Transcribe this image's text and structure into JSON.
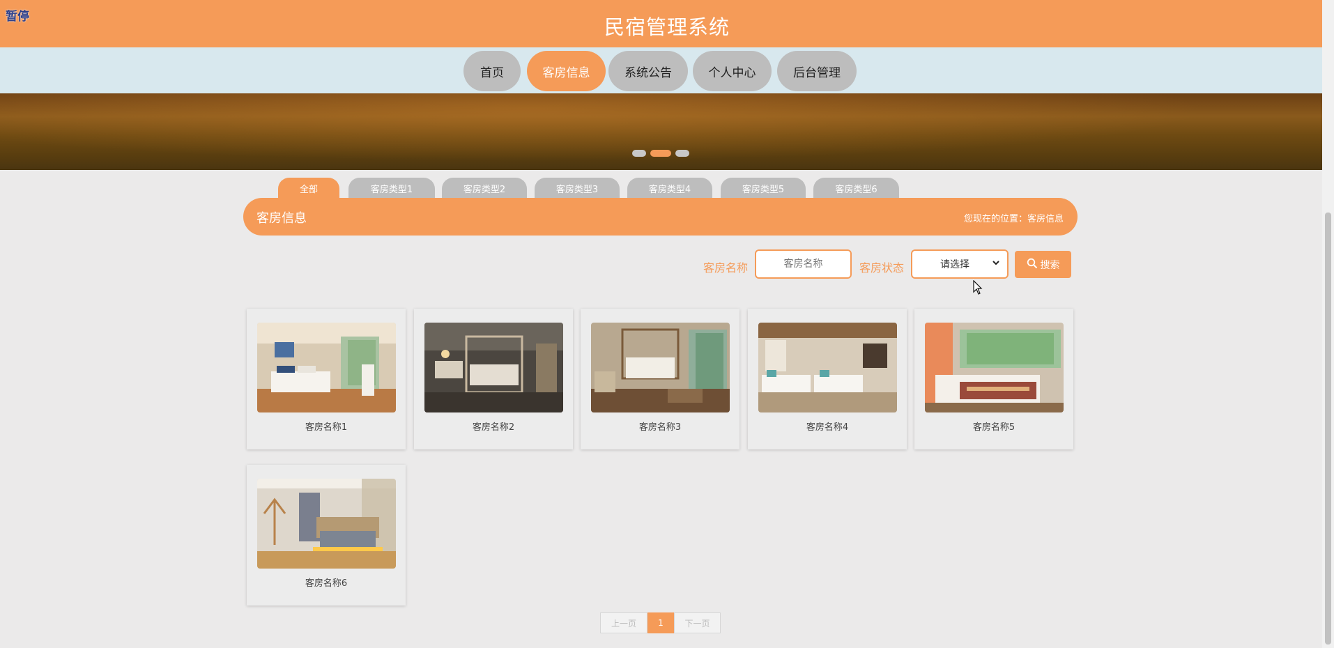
{
  "overlay": {
    "pause_label": "暂停"
  },
  "header": {
    "title": "民宿管理系统"
  },
  "nav": {
    "items": [
      {
        "label": "首页"
      },
      {
        "label": "客房信息"
      },
      {
        "label": "系统公告"
      },
      {
        "label": "个人中心"
      },
      {
        "label": "后台管理"
      }
    ],
    "active_index": 1
  },
  "banner": {
    "slide_count": 3,
    "active_slide": 2
  },
  "categories": {
    "tabs": [
      {
        "label": "全部"
      },
      {
        "label": "客房类型1"
      },
      {
        "label": "客房类型2"
      },
      {
        "label": "客房类型3"
      },
      {
        "label": "客房类型4"
      },
      {
        "label": "客房类型5"
      },
      {
        "label": "客房类型6"
      }
    ],
    "active_index": 0
  },
  "section": {
    "title": "客房信息",
    "breadcrumb": "您现在的位置：客房信息"
  },
  "search": {
    "name_label": "客房名称",
    "name_placeholder": "客房名称",
    "status_label": "客房状态",
    "status_value": "请选择",
    "button_label": "搜索"
  },
  "rooms": [
    {
      "name": "客房名称1"
    },
    {
      "name": "客房名称2"
    },
    {
      "name": "客房名称3"
    },
    {
      "name": "客房名称4"
    },
    {
      "name": "客房名称5"
    },
    {
      "name": "客房名称6"
    }
  ],
  "pagination": {
    "prev": "上一页",
    "current": "1",
    "next": "下一页"
  },
  "colors": {
    "accent": "#f59b58",
    "nav_bg": "#d8e8ee",
    "inactive_tab": "#bdbdbd",
    "page_bg": "#ebeaea"
  }
}
